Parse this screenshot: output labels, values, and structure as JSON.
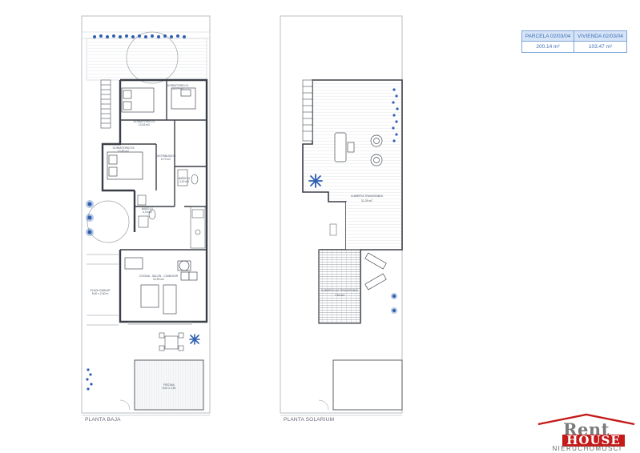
{
  "area_table": {
    "parcela_label": "PARCELA 02/03/04",
    "vivienda_label": "VIVIENDA 02/03/04",
    "parcela_value": "200.14 m²",
    "vivienda_value": "103.47 m²"
  },
  "ground_floor": {
    "title": "PLANTA BAJA",
    "rooms": {
      "dormitorio_01": "DORMITORIO 01",
      "dormitorio_01_area": "11,07 m2",
      "dormitorio_02": "DORMITORIO 02",
      "dormitorio_02_area": "13,43 m2",
      "dormitorio_03": "DORMITORIO 03",
      "dormitorio_03_area": "10,85 m2",
      "distribuidor": "DISTRIBUIDOR",
      "distribuidor_area": "6,72 m2",
      "bano_01": "BAÑO 01",
      "bano_01_area": "4,78 m2",
      "bano_02": "BAÑO 02",
      "bano_02_area": "4,32 m2",
      "cocina": "COCINA - SALON - COMEDOR",
      "cocina_area": "24,93 m2",
      "plaza_garaje": "PLAZA GARAJE",
      "plaza_garaje_area": "5,00 x 2,50 m",
      "piscina": "PISCINA",
      "piscina_area": "5,00 x 2,50"
    }
  },
  "solarium": {
    "title": "PLANTA SOLARIUM",
    "rooms": {
      "cubierta_1": "CUBIERTA TRANSITABLE",
      "cubierta_1_area": "31,28 m2",
      "cubierta_2": "CUBIERTA NO TRANSITABLE",
      "cubierta_2_area": "7,50 m2"
    }
  },
  "logo": {
    "line1": "Rent",
    "line2": "HOUSE",
    "line3": "NIERUCHOMOŚCI"
  },
  "colors": {
    "wall": "#3a3f47",
    "thin_line": "#8a9099",
    "plant": "#2f5fb0",
    "logo_red": "#c41a1a"
  }
}
